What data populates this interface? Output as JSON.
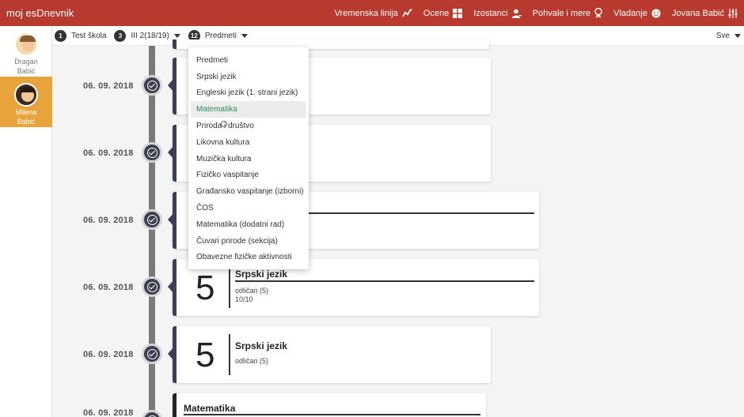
{
  "app": {
    "title": "moj esDnevnik"
  },
  "topnav": [
    {
      "label": "Vremenska linija",
      "icon": "timeline-icon"
    },
    {
      "label": "Ocene",
      "icon": "grid-icon"
    },
    {
      "label": "Izostanci",
      "icon": "user-minus-icon"
    },
    {
      "label": "Pohvale i mere",
      "icon": "award-icon"
    },
    {
      "label": "Vladanje",
      "icon": "smile-icon"
    },
    {
      "label": "Jovana Babić",
      "icon": "settings-sliders-icon"
    }
  ],
  "students": [
    {
      "first": "Dragan",
      "last": "Babić",
      "active": false
    },
    {
      "first": "Milena",
      "last": "Babić",
      "active": true
    }
  ],
  "filters": {
    "school": {
      "num": "1",
      "label": "Test škola"
    },
    "class": {
      "num": "3",
      "label": "III 2(18/19)"
    },
    "subject": {
      "num": "12",
      "label": "Predmeti"
    },
    "right": "Sve"
  },
  "dropdown": {
    "items": [
      "Predmeti",
      "Srpski jezik",
      "Engleski jezik (1. strani jezik)",
      "Matematika",
      "Priroda i društvo",
      "Likovna kultura",
      "Muzička kultura",
      "Fizičko vaspitanje",
      "Građansko vaspitanje (izborni)",
      "ČOS",
      "Matematika (dodatni rad)",
      "Čuvari prirode (sekcija)",
      "Obavezne fizičke aktivnosti"
    ],
    "selected_index": 3
  },
  "timeline": [
    {
      "date": "06. 09. 2018"
    },
    {
      "date": "06. 09. 2018"
    },
    {
      "date": "06. 09. 2018"
    },
    {
      "date": "06. 09. 2018",
      "grade": "5",
      "subject": "Srpski jezik",
      "desc": "odličan (5)",
      "score": "10/10"
    },
    {
      "date": "06. 09. 2018",
      "grade": "5",
      "subject": "Srpski jezik",
      "desc": "odličan (5)"
    },
    {
      "date": "06. 09. 2018",
      "subject": "Matematika"
    }
  ]
}
